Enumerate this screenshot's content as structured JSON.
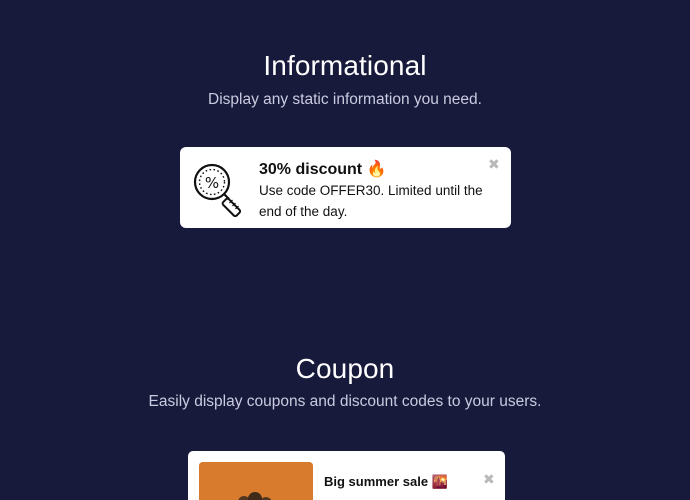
{
  "informational": {
    "title": "Informational",
    "subtitle": "Display any static information you need.",
    "notice": {
      "icon": "discount-magnifier-icon",
      "title": "30% discount 🔥",
      "body": "Use code OFFER30. Limited until the end of the day.",
      "close": "✖"
    }
  },
  "coupon": {
    "title": "Coupon",
    "subtitle": "Easily display coupons and discount codes to your users.",
    "card": {
      "image": "summer-photo",
      "title": "Big summer sale 🌇",
      "close": "✖"
    }
  },
  "colors": {
    "background": "#181a3b",
    "card": "#ffffff",
    "coupon_image": "#d97b2c"
  }
}
